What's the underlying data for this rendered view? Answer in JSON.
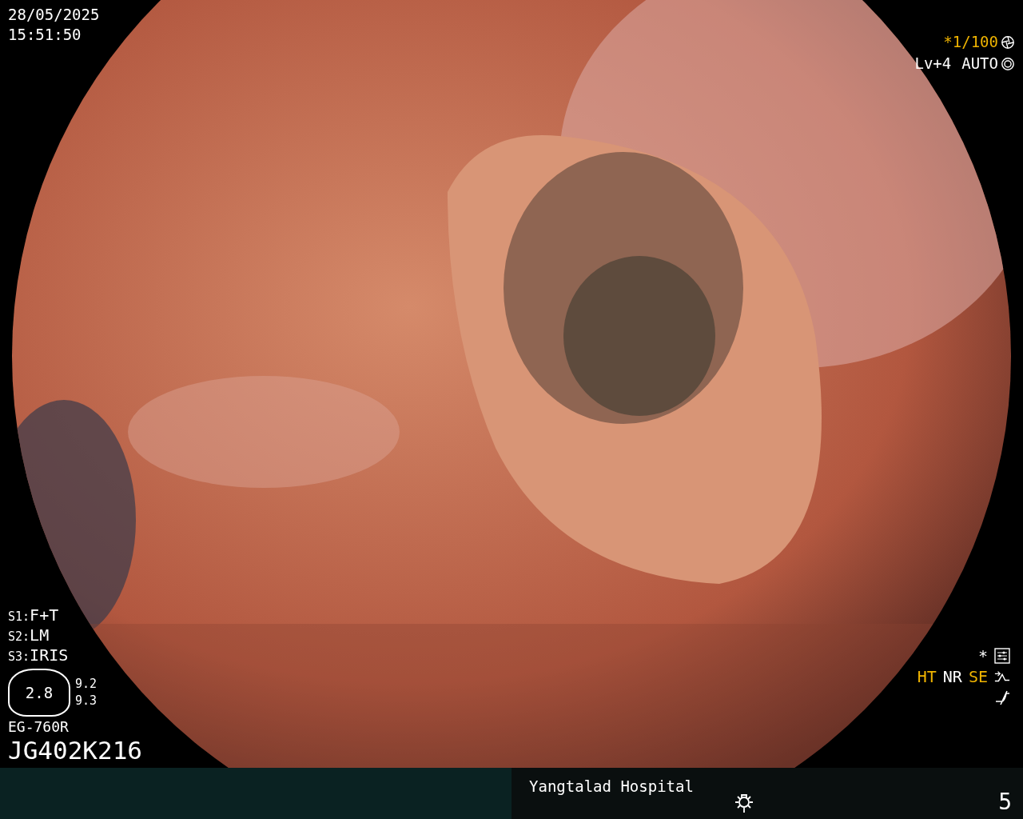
{
  "date": "28/05/2025",
  "time": "15:51:50",
  "shutter": "*1/100",
  "exposure": {
    "level": "Lv+4",
    "mode": "AUTO"
  },
  "settings": [
    {
      "key": "S1:",
      "value": "F+T"
    },
    {
      "key": "S2:",
      "value": "LM"
    },
    {
      "key": "S3:",
      "value": "IRIS"
    }
  ],
  "gauge": {
    "value": "2.8",
    "readings": [
      "9.2",
      "9.3"
    ]
  },
  "scope_model": "EG-760R",
  "serial": "JG402K216",
  "indicators": [
    {
      "text": "*",
      "highlighted": false,
      "kind": "settings"
    },
    {
      "text": "HT",
      "highlighted": true,
      "kind": "none"
    },
    {
      "text": "NR",
      "highlighted": false,
      "kind": "none"
    },
    {
      "text": "SE",
      "highlighted": true,
      "kind": "enhance"
    },
    {
      "kind": "filter"
    }
  ],
  "footer": {
    "hospital": "Yangtalad Hospital",
    "number": "5"
  }
}
